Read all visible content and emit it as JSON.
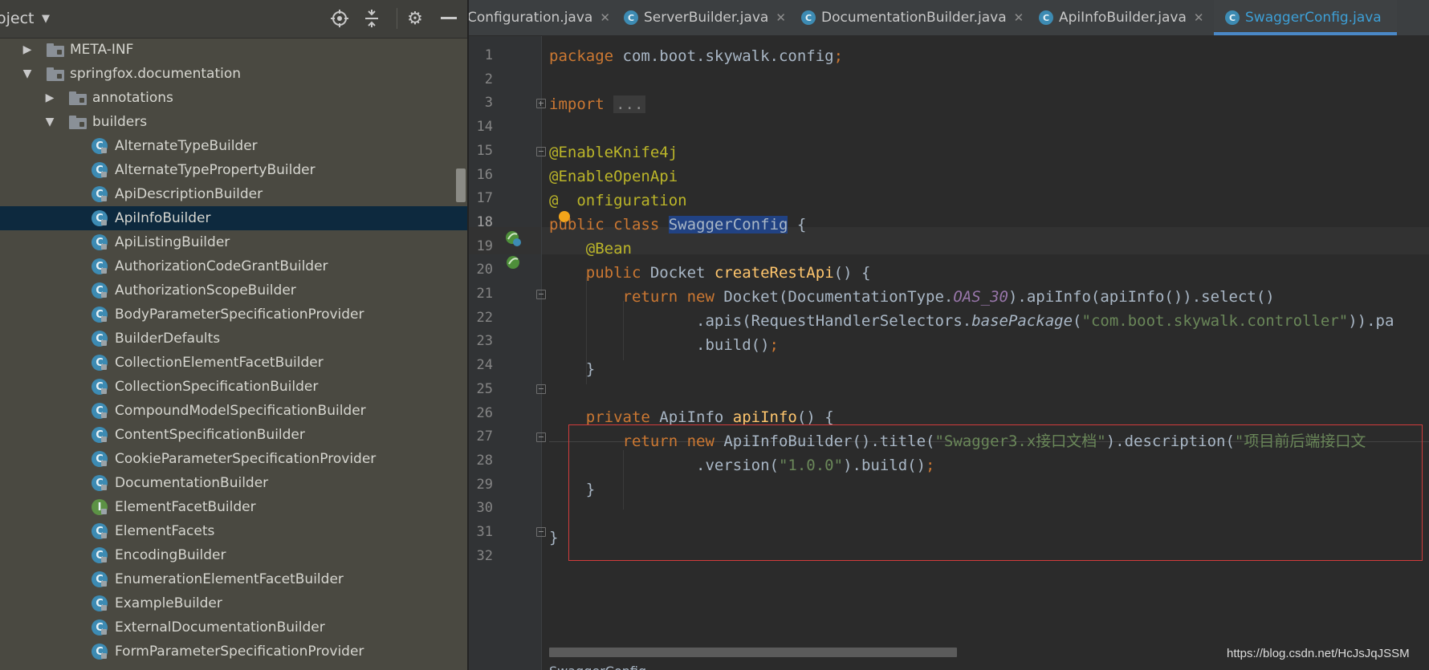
{
  "project_panel": {
    "title": "oject",
    "icons": [
      "target-icon",
      "collapse-icon",
      "gear-icon",
      "minimize-icon"
    ]
  },
  "tree": [
    {
      "label": "META-INF",
      "type": "folder",
      "expanded": false,
      "depth": 1
    },
    {
      "label": "springfox.documentation",
      "type": "folder",
      "expanded": true,
      "depth": 1
    },
    {
      "label": "annotations",
      "type": "folder",
      "expanded": false,
      "depth": 2
    },
    {
      "label": "builders",
      "type": "folder",
      "expanded": true,
      "depth": 2
    },
    {
      "label": "AlternateTypeBuilder",
      "type": "class",
      "depth": 3
    },
    {
      "label": "AlternateTypePropertyBuilder",
      "type": "class",
      "depth": 3
    },
    {
      "label": "ApiDescriptionBuilder",
      "type": "class",
      "depth": 3
    },
    {
      "label": "ApiInfoBuilder",
      "type": "class",
      "depth": 3,
      "selected": true
    },
    {
      "label": "ApiListingBuilder",
      "type": "class",
      "depth": 3
    },
    {
      "label": "AuthorizationCodeGrantBuilder",
      "type": "class",
      "depth": 3
    },
    {
      "label": "AuthorizationScopeBuilder",
      "type": "class",
      "depth": 3
    },
    {
      "label": "BodyParameterSpecificationProvider",
      "type": "class",
      "depth": 3
    },
    {
      "label": "BuilderDefaults",
      "type": "class",
      "depth": 3
    },
    {
      "label": "CollectionElementFacetBuilder",
      "type": "class",
      "depth": 3
    },
    {
      "label": "CollectionSpecificationBuilder",
      "type": "class",
      "depth": 3
    },
    {
      "label": "CompoundModelSpecificationBuilder",
      "type": "class",
      "depth": 3
    },
    {
      "label": "ContentSpecificationBuilder",
      "type": "class",
      "depth": 3
    },
    {
      "label": "CookieParameterSpecificationProvider",
      "type": "class",
      "depth": 3
    },
    {
      "label": "DocumentationBuilder",
      "type": "class",
      "depth": 3
    },
    {
      "label": "ElementFacetBuilder",
      "type": "interface",
      "depth": 3
    },
    {
      "label": "ElementFacets",
      "type": "class",
      "depth": 3
    },
    {
      "label": "EncodingBuilder",
      "type": "class",
      "depth": 3
    },
    {
      "label": "EnumerationElementFacetBuilder",
      "type": "class",
      "depth": 3
    },
    {
      "label": "ExampleBuilder",
      "type": "class",
      "depth": 3
    },
    {
      "label": "ExternalDocumentationBuilder",
      "type": "class",
      "depth": 3
    },
    {
      "label": "FormParameterSpecificationProvider",
      "type": "class",
      "depth": 3
    }
  ],
  "tabs": [
    {
      "label": "Configuration.java",
      "active": false
    },
    {
      "label": "ServerBuilder.java",
      "active": false
    },
    {
      "label": "DocumentationBuilder.java",
      "active": false
    },
    {
      "label": "ApiInfoBuilder.java",
      "active": false
    },
    {
      "label": "SwaggerConfig.java",
      "active": true
    }
  ],
  "editor": {
    "line_numbers": [
      "1",
      "2",
      "3",
      "14",
      "15",
      "16",
      "17",
      "18",
      "19",
      "20",
      "21",
      "22",
      "23",
      "24",
      "25",
      "26",
      "27",
      "28",
      "29",
      "30",
      "31",
      "32"
    ],
    "current_line": "18",
    "breadcrumb": "SwaggerConfig",
    "code": {
      "l1_kw": "package",
      "l1_pkg": " com.boot.skywalk.config",
      "l1_semi": ";",
      "l3_kw": "import",
      "l3_fold": "...",
      "l15": "@EnableKnife4j",
      "l16": "@EnableOpenApi",
      "l17_at": "@",
      "l17_rest": "onfiguration",
      "l18_kw": "public class",
      "l18_cls": "SwaggerConfig",
      "l18_brace": " {",
      "l19": "@Bean",
      "l20_kw": "public",
      "l20_type": " Docket ",
      "l20_fn": "createRestApi",
      "l20_rest": "() {",
      "l21_kw": "return new",
      "l21_a": " Docket(DocumentationType.",
      "l21_const": "OAS_30",
      "l21_b": ").apiInfo(apiInfo()).select()",
      "l22_a": ".apis(RequestHandlerSelectors.",
      "l22_it": "basePackage",
      "l22_b": "(",
      "l22_str": "\"com.boot.skywalk.controller\"",
      "l22_c": ")).pa",
      "l23_a": ".build()",
      "l23_semi": ";",
      "l24": "}",
      "l26_kw": "private",
      "l26_type": " ApiInfo ",
      "l26_fn": "apiInfo",
      "l26_rest": "() {",
      "l27_kw": "return new",
      "l27_a": " ApiInfoBuilder().title(",
      "l27_str1": "\"Swagger3.x接口文档\"",
      "l27_b": ").description(",
      "l27_str2": "\"项目前后端接口文",
      "l28_a": ".version(",
      "l28_str": "\"1.0.0\"",
      "l28_b": ").build()",
      "l28_semi": ";",
      "l29": "}",
      "l31": "}"
    }
  },
  "watermark": "https://blog.csdn.net/HcJsJqJSSM",
  "colors": {
    "sidebar_bg": "#4a4941",
    "selection_bg": "#0d293e",
    "editor_bg": "#2b2b2b",
    "keyword": "#cc7832",
    "annotation": "#bbb529",
    "string": "#6a8759",
    "function": "#ffc66d",
    "active_tab": "#3d9fd6",
    "highlight_box": "#d23c3c"
  }
}
